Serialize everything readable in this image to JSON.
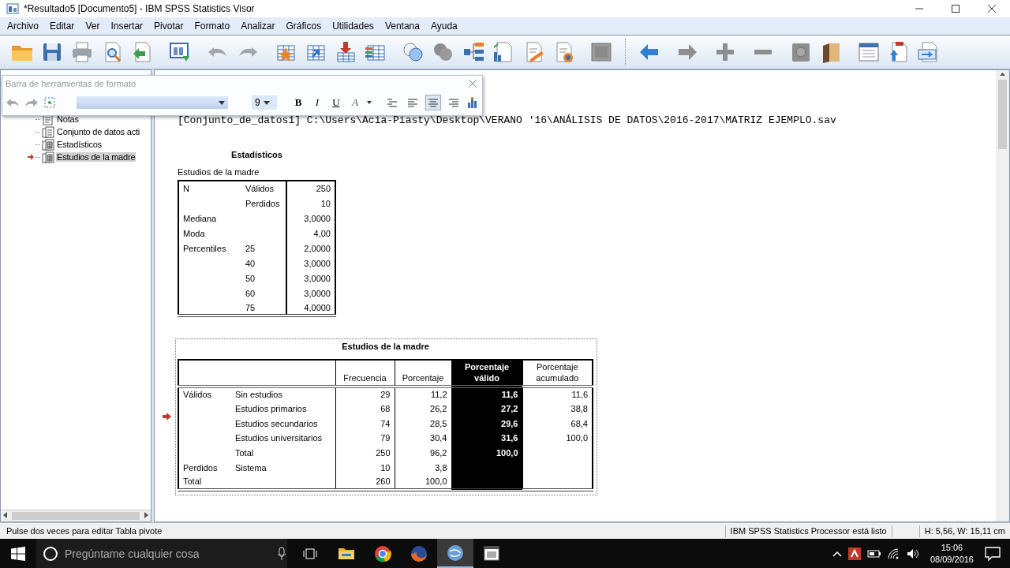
{
  "window": {
    "title": "*Resultado5 [Documento5] - IBM SPSS Statistics Visor"
  },
  "menu": [
    "Archivo",
    "Editar",
    "Ver",
    "Insertar",
    "Pivotar",
    "Formato",
    "Analizar",
    "Gráficos",
    "Utilidades",
    "Ventana",
    "Ayuda"
  ],
  "format_toolbar": {
    "title": "Barra de herramientas de formato",
    "size": "9",
    "style_buttons": [
      "B",
      "I",
      "U",
      "A"
    ],
    "alignments": [
      {
        "kind": "distributed",
        "selected": false
      },
      {
        "kind": "left",
        "selected": false
      },
      {
        "kind": "center",
        "selected": true
      },
      {
        "kind": "right",
        "selected": false
      }
    ]
  },
  "outline": {
    "items": [
      {
        "label": "Notas",
        "kind": "notes",
        "current": false
      },
      {
        "label": "Conjunto de datos acti",
        "kind": "dataset",
        "current": false
      },
      {
        "label": "Estadísticos",
        "kind": "table",
        "current": false
      },
      {
        "label": "Estudios de la madre",
        "kind": "table",
        "current": true
      }
    ]
  },
  "document": {
    "dataset_line": "[Conjunto_de_datos1] C:\\Users\\Acia-Piasty\\Desktop\\VERANO '16\\ANÁLISIS DE DATOS\\2016-2017\\MATRIZ EJEMPLO.sav",
    "statistics": {
      "title": "Estadísticos",
      "subtitle": "Estudios de la madre",
      "rows": [
        {
          "label": "N",
          "sublabel": "Válidos",
          "value": "250"
        },
        {
          "sublabel": "Perdidos",
          "value": "10"
        },
        {
          "label": "Mediana",
          "value": "3,0000"
        },
        {
          "label": "Moda",
          "value": "4,00"
        },
        {
          "label": "Percentiles",
          "sublabel": "25",
          "value": "2,0000"
        },
        {
          "sublabel": "40",
          "value": "3,0000"
        },
        {
          "sublabel": "50",
          "value": "3,0000"
        },
        {
          "sublabel": "60",
          "value": "3,0000"
        },
        {
          "sublabel": "75",
          "value": "4,0000"
        }
      ]
    },
    "frequencies": {
      "title": "Estudios de la madre",
      "current": true,
      "selected": true,
      "columns": [
        {
          "label": "Frecuencia",
          "selected": false
        },
        {
          "label": "Porcentaje",
          "selected": false
        },
        {
          "label": "Porcentaje válido",
          "selected": true
        },
        {
          "label": "Porcentaje acumulado",
          "selected": false
        }
      ],
      "rows": [
        {
          "group": "Válidos",
          "category": "Sin estudios",
          "values": [
            "29",
            "11,2",
            "11,6",
            "11,6"
          ]
        },
        {
          "category": "Estudios primarios",
          "values": [
            "68",
            "26,2",
            "27,2",
            "38,8"
          ]
        },
        {
          "category": "Estudios secundarios",
          "values": [
            "74",
            "28,5",
            "29,6",
            "68,4"
          ]
        },
        {
          "category": "Estudios universitarios",
          "values": [
            "79",
            "30,4",
            "31,6",
            "100,0"
          ]
        },
        {
          "category": "Total",
          "values": [
            "250",
            "96,2",
            "100,0"
          ]
        },
        {
          "group": "Perdidos",
          "category": "Sistema",
          "values": [
            "10",
            "3,8"
          ]
        },
        {
          "group": "Total",
          "values": [
            "260",
            "100,0"
          ]
        }
      ]
    }
  },
  "status_bar": {
    "message": "Pulse dos veces para editar Tabla pivote",
    "processor": "IBM SPSS Statistics Processor está listo",
    "size": "H: 5,56, W: 15,11 cm"
  },
  "taskbar": {
    "search_placeholder": "Pregúntame cualquier cosa",
    "time": "15:06",
    "date": "08/09/2016",
    "apps": [
      {
        "kind": "explorer",
        "active": false
      },
      {
        "kind": "chrome",
        "active": false
      },
      {
        "kind": "firefox",
        "active": false
      },
      {
        "kind": "spss",
        "active": true
      },
      {
        "kind": "viewer",
        "active": false
      }
    ]
  }
}
